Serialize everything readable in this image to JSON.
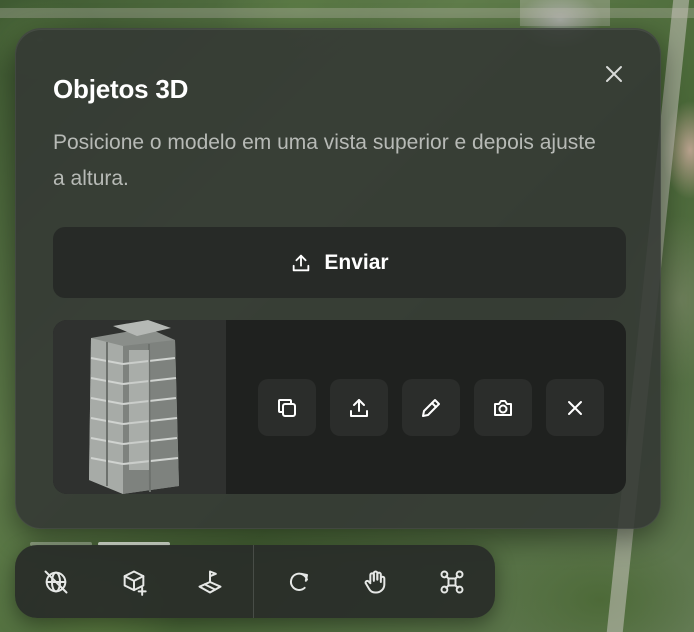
{
  "panel": {
    "title": "Objetos 3D",
    "description": "Posicione o modelo em uma vista superior e depois ajuste a altura.",
    "upload_label": "Enviar",
    "model_card": {
      "actions": [
        "duplicate-icon",
        "export-icon",
        "edit-icon",
        "camera-icon",
        "remove-icon"
      ]
    }
  },
  "toolbar": {
    "tools": [
      "globe-off-icon",
      "cube-add-icon",
      "flag-map-icon",
      "rotate-icon",
      "hand-icon",
      "drone-icon"
    ]
  },
  "colors": {
    "panel_bg": "#343834",
    "button_bg": "#272a27",
    "text_primary": "#ffffff",
    "text_secondary": "#b7bab6"
  }
}
